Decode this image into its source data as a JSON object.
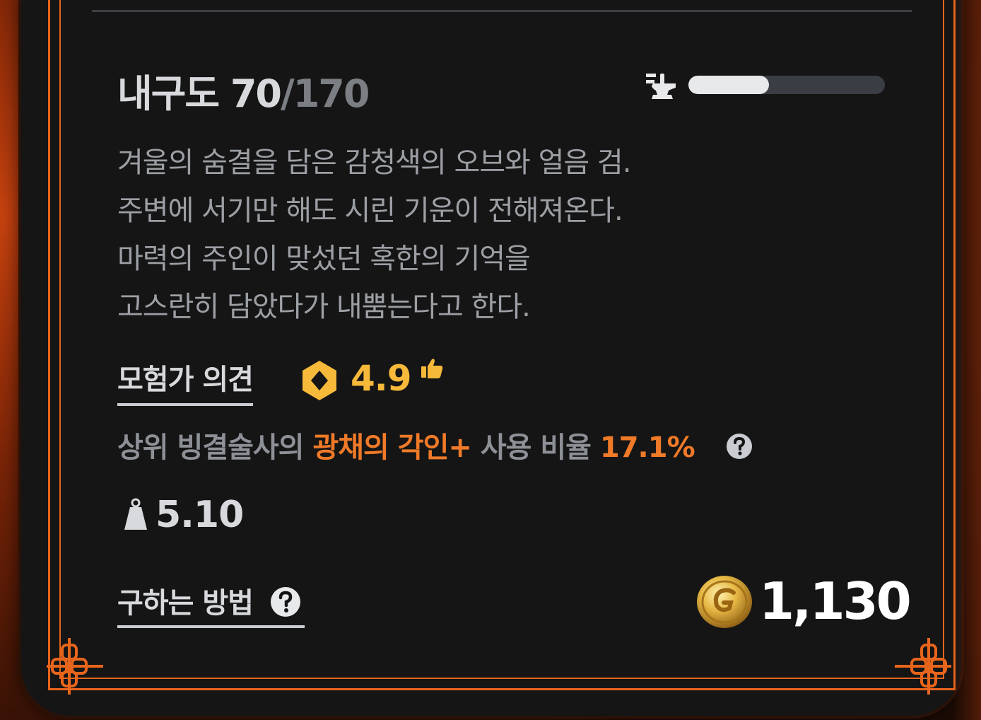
{
  "durability": {
    "label": "내구도",
    "current": "70",
    "max": "/170",
    "fraction": 0.41,
    "icon": "anvil-icon"
  },
  "description": [
    "겨울의 숨결을 담은 감청색의 오브와 얼음 검.",
    "주변에 서기만 해도 시린 기운이 전해져온다.",
    "마력의 주인이 맞섰던 혹한의 기억을",
    "고스란히 담았다가 내뿜는다고 한다."
  ],
  "review": {
    "label": "모험가 의견",
    "score": "4.9",
    "badge_color": "#f6b93a",
    "icons": [
      "rating-badge-icon",
      "thumbs-up-icon"
    ]
  },
  "usage": {
    "prefix": "상위 빙결술사의 ",
    "engraving": "광채의 각인+",
    "middle": " 사용 비율 ",
    "percent": "17.1%",
    "highlight_color": "#f07a28",
    "icon": "help-icon"
  },
  "weight": {
    "value": "5.10",
    "icon": "weight-icon"
  },
  "howto": {
    "label": "구하는 방법",
    "icon": "help-icon"
  },
  "price": {
    "value": "1,130",
    "icon": "gold-coin-icon"
  },
  "colors": {
    "panel": "#151515",
    "frame": "#e8651c",
    "text_primary": "#d7d9dc",
    "text_secondary": "#9c9fa4"
  }
}
